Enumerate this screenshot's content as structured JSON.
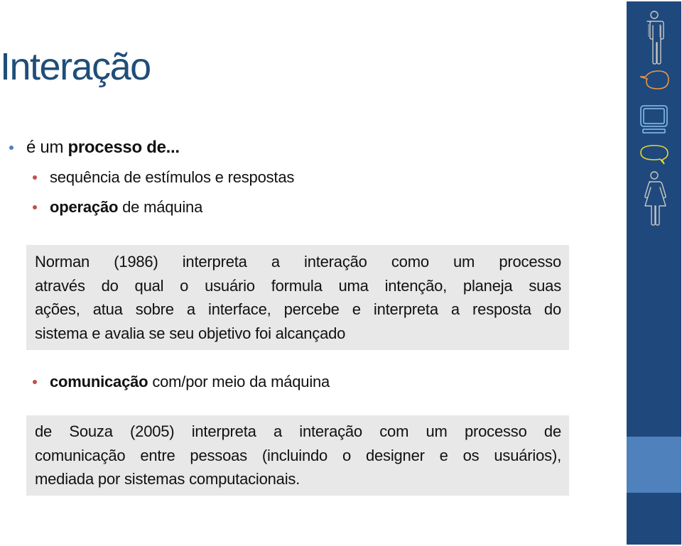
{
  "slide": {
    "title": "Interação",
    "bullet1": {
      "prefix": "é um ",
      "bold": "processo de..."
    },
    "sub_bullets": [
      {
        "bold": "",
        "text": "sequência de estímulos e respostas"
      },
      {
        "bold": "operação",
        "text": " de máquina"
      }
    ],
    "norman_box": {
      "lines": [
        "Norman (1986) interpreta a interação como um processo",
        "através do qual o usuário formula uma intenção, planeja suas",
        "ações, atua sobre a interface, percebe e interpreta a resposta do",
        "sistema e avalia se seu objetivo foi alcançado"
      ]
    },
    "bullet_comunicacao": {
      "bold": "comunicação",
      "text": " com/por meio da máquina"
    },
    "souza_box": {
      "lines": [
        "de Souza (2005) interpreta a interação com um processo de",
        "comunicação entre pessoas (incluindo o designer e os usuários),",
        "mediada por sistemas computacionais."
      ]
    }
  },
  "sidebar": {
    "icons": [
      "man-icon",
      "speech-bubble-orange-icon",
      "monitor-icon",
      "speech-bubble-yellow-icon",
      "woman-icon"
    ],
    "colors": {
      "background": "#1F497D",
      "band": "#4F81BD",
      "figure_stroke": "#C8C8C0",
      "bubble_orange": "#E8964A",
      "monitor_stroke": "#8EC3F0",
      "bubble_yellow": "#E6D62E"
    }
  },
  "colors": {
    "title": "#1F4E79",
    "bullet_level1": "#4F81BD",
    "bullet_level2": "#C0504D",
    "box_background": "#E8E8E8"
  }
}
